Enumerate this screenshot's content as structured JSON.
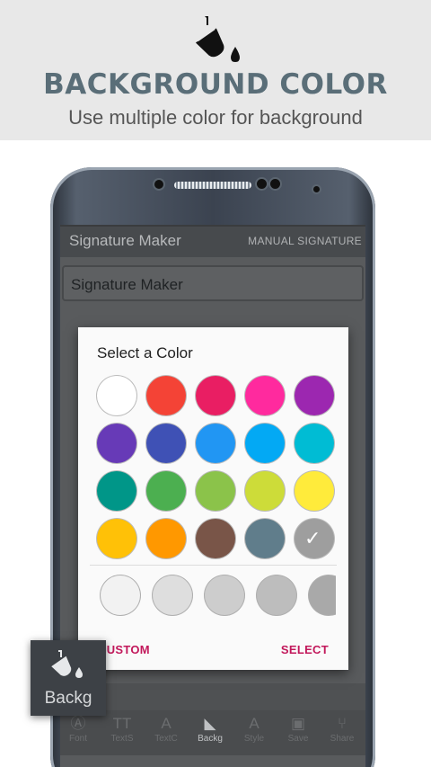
{
  "promo": {
    "icon": "paint-bucket-icon",
    "title": "BACKGROUND COLOR",
    "subtitle": "Use multiple color for background"
  },
  "app": {
    "title": "Signature Maker",
    "action": "MANUAL SIGNATURE",
    "input_value": "Signature Maker"
  },
  "dialog": {
    "title": "Select a Color",
    "swatches": [
      "#ffffff",
      "#f44336",
      "#e91e63",
      "#ff2a9e",
      "#9c27b0",
      "#673ab7",
      "#3f51b5",
      "#2196f3",
      "#03a9f4",
      "#00bcd4",
      "#009688",
      "#4caf50",
      "#8bc34a",
      "#cddc39",
      "#ffeb3b",
      "#ffc107",
      "#ff9800",
      "#795548",
      "#607d8b",
      "#9e9e9e"
    ],
    "selected_index": 19,
    "shades": [
      "#f2f2f2",
      "#dedede",
      "#cdcdcd",
      "#bdbdbd",
      "#a9a9a9"
    ],
    "custom_label": "CUSTOM",
    "select_label": "SELECT",
    "accent": "#c2185b"
  },
  "nav": {
    "items": [
      {
        "label": "Font",
        "icon": "font-icon"
      },
      {
        "label": "TextS",
        "icon": "text-size-icon"
      },
      {
        "label": "TextC",
        "icon": "text-color-icon"
      },
      {
        "label": "Backg",
        "icon": "paint-bucket-icon"
      },
      {
        "label": "Style",
        "icon": "text-style-icon"
      },
      {
        "label": "Save",
        "icon": "save-icon"
      },
      {
        "label": "Share",
        "icon": "share-icon"
      }
    ],
    "active_index": 3
  },
  "tooltip": {
    "label": "Backg",
    "icon": "paint-bucket-icon"
  }
}
